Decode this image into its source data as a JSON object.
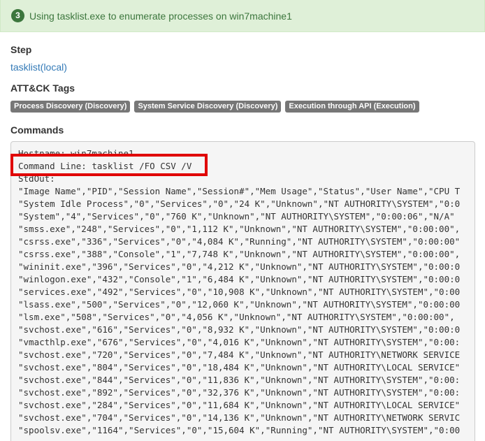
{
  "header": {
    "step_number": "3",
    "title": "Using tasklist.exe to enumerate processes on win7machine1"
  },
  "step_section": {
    "label": "Step",
    "link_text": "tasklist(local)"
  },
  "tags_section": {
    "label": "ATT&CK Tags",
    "tags": [
      "Process Discovery (Discovery)",
      "System Service Discovery (Discovery)",
      "Execution through API (Execution)"
    ]
  },
  "commands_section": {
    "label": "Commands",
    "lines": [
      "Hostname: win7machine1",
      "Command Line: tasklist /FO CSV /V",
      "StdOut:",
      "\"Image Name\",\"PID\",\"Session Name\",\"Session#\",\"Mem Usage\",\"Status\",\"User Name\",\"CPU T",
      "\"System Idle Process\",\"0\",\"Services\",\"0\",\"24 K\",\"Unknown\",\"NT AUTHORITY\\SYSTEM\",\"0:0",
      "\"System\",\"4\",\"Services\",\"0\",\"760 K\",\"Unknown\",\"NT AUTHORITY\\SYSTEM\",\"0:00:06\",\"N/A\"",
      "\"smss.exe\",\"248\",\"Services\",\"0\",\"1,112 K\",\"Unknown\",\"NT AUTHORITY\\SYSTEM\",\"0:00:00\",",
      "\"csrss.exe\",\"336\",\"Services\",\"0\",\"4,084 K\",\"Running\",\"NT AUTHORITY\\SYSTEM\",\"0:00:00\"",
      "\"csrss.exe\",\"388\",\"Console\",\"1\",\"7,748 K\",\"Unknown\",\"NT AUTHORITY\\SYSTEM\",\"0:00:00\",",
      "\"wininit.exe\",\"396\",\"Services\",\"0\",\"4,212 K\",\"Unknown\",\"NT AUTHORITY\\SYSTEM\",\"0:00:0",
      "\"winlogon.exe\",\"432\",\"Console\",\"1\",\"6,484 K\",\"Unknown\",\"NT AUTHORITY\\SYSTEM\",\"0:00:0",
      "\"services.exe\",\"492\",\"Services\",\"0\",\"10,908 K\",\"Unknown\",\"NT AUTHORITY\\SYSTEM\",\"0:00",
      "\"lsass.exe\",\"500\",\"Services\",\"0\",\"12,060 K\",\"Unknown\",\"NT AUTHORITY\\SYSTEM\",\"0:00:00",
      "\"lsm.exe\",\"508\",\"Services\",\"0\",\"4,056 K\",\"Unknown\",\"NT AUTHORITY\\SYSTEM\",\"0:00:00\",",
      "\"svchost.exe\",\"616\",\"Services\",\"0\",\"8,932 K\",\"Unknown\",\"NT AUTHORITY\\SYSTEM\",\"0:00:0",
      "\"vmacthlp.exe\",\"676\",\"Services\",\"0\",\"4,016 K\",\"Unknown\",\"NT AUTHORITY\\SYSTEM\",\"0:00:",
      "\"svchost.exe\",\"720\",\"Services\",\"0\",\"7,484 K\",\"Unknown\",\"NT AUTHORITY\\NETWORK SERVICE",
      "\"svchost.exe\",\"804\",\"Services\",\"0\",\"18,484 K\",\"Unknown\",\"NT AUTHORITY\\LOCAL SERVICE\"",
      "\"svchost.exe\",\"844\",\"Services\",\"0\",\"11,836 K\",\"Unknown\",\"NT AUTHORITY\\SYSTEM\",\"0:00:",
      "\"svchost.exe\",\"892\",\"Services\",\"0\",\"32,376 K\",\"Unknown\",\"NT AUTHORITY\\SYSTEM\",\"0:00:",
      "\"svchost.exe\",\"284\",\"Services\",\"0\",\"11,684 K\",\"Unknown\",\"NT AUTHORITY\\LOCAL SERVICE\"",
      "\"svchost.exe\",\"704\",\"Services\",\"0\",\"14,136 K\",\"Unknown\",\"NT AUTHORITY\\NETWORK SERVIC",
      "\"spoolsv.exe\",\"1164\",\"Services\",\"0\",\"15,604 K\",\"Running\",\"NT AUTHORITY\\SYSTEM\",\"0:00"
    ]
  },
  "colors": {
    "header_bg": "#dff0d8",
    "header_text": "#3c763d",
    "link": "#337ab7",
    "tag_bg": "#777777",
    "highlight": "#e00000"
  }
}
